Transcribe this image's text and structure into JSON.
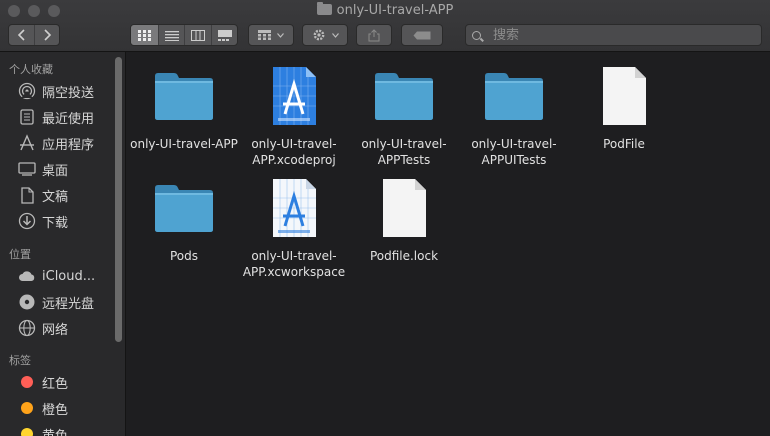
{
  "window": {
    "title": "only-UI-travel-APP"
  },
  "toolbar": {
    "nav": {
      "back_icon": "chevron-left-icon",
      "forward_icon": "chevron-right-icon"
    },
    "view_modes": [
      "icon-view-icon",
      "list-view-icon",
      "column-view-icon",
      "gallery-view-icon"
    ],
    "search": {
      "placeholder": "搜索"
    }
  },
  "sidebar": {
    "sections": [
      {
        "title": "个人收藏",
        "items": [
          {
            "label": "隔空投送",
            "icon": "airdrop-icon"
          },
          {
            "label": "最近使用",
            "icon": "recents-icon"
          },
          {
            "label": "应用程序",
            "icon": "applications-icon"
          },
          {
            "label": "桌面",
            "icon": "desktop-icon"
          },
          {
            "label": "文稿",
            "icon": "documents-icon"
          },
          {
            "label": "下载",
            "icon": "downloads-icon"
          }
        ]
      },
      {
        "title": "位置",
        "items": [
          {
            "label": "iCloud...",
            "icon": "cloud-icon"
          },
          {
            "label": "远程光盘",
            "icon": "disc-icon"
          },
          {
            "label": "网络",
            "icon": "network-icon"
          }
        ]
      },
      {
        "title": "标签",
        "items": [
          {
            "label": "红色",
            "color": "#ff5f57"
          },
          {
            "label": "橙色",
            "color": "#ffa31a"
          },
          {
            "label": "黄色",
            "color": "#ffd52e"
          }
        ]
      }
    ]
  },
  "files": [
    {
      "name": "only-UI-travel-APP",
      "type": "folder"
    },
    {
      "name": "only-UI-travel-APP.xcodeproj",
      "type": "xcodeproj"
    },
    {
      "name": "only-UI-travel-APPTests",
      "type": "folder"
    },
    {
      "name": "only-UI-travel-APPUITests",
      "type": "folder"
    },
    {
      "name": "PodFile",
      "type": "document"
    },
    {
      "name": "Pods",
      "type": "folder"
    },
    {
      "name": "only-UI-travel-APP.xcworkspace",
      "type": "xcworkspace"
    },
    {
      "name": "Podfile.lock",
      "type": "document"
    }
  ],
  "colors": {
    "folder": "#4fa3d1",
    "folder_dark": "#3a86b4",
    "xcode_blue": "#2d7fe0"
  }
}
